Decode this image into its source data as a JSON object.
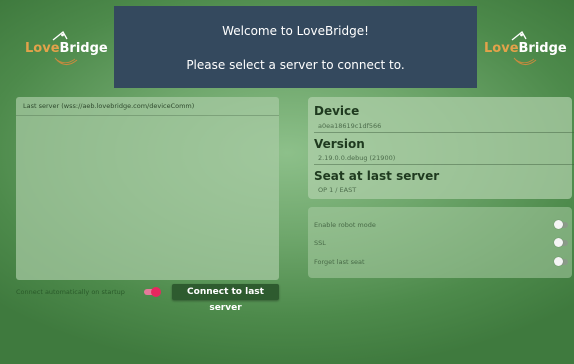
{
  "logo": {
    "love": "Love",
    "bridge": "Bridge"
  },
  "banner": {
    "welcome": "Welcome to LoveBridge!",
    "instruction": "Please select a server to connect to."
  },
  "server_panel": {
    "header": "Last server (wss://aeb.lovebridge.com/deviceComm)"
  },
  "auto_connect": {
    "label": "Connect automatically on startup",
    "enabled": true
  },
  "connect_button": {
    "label": "Connect to last server"
  },
  "device_info": {
    "device_title": "Device",
    "device_value": "a0ea18619c1df566",
    "version_title": "Version",
    "version_value": "2.19.0.0.debug (21900)",
    "seat_title": "Seat at last server",
    "seat_value": "OP 1 / EAST"
  },
  "settings": [
    {
      "label": "Enable robot mode",
      "enabled": false
    },
    {
      "label": "SSL",
      "enabled": false
    },
    {
      "label": "Forget last seat",
      "enabled": false
    }
  ],
  "colors": {
    "banner_bg": "#34495e",
    "button_bg": "#2e5b2f",
    "toggle_on": "#e8275f",
    "love": "#e3a24a"
  }
}
